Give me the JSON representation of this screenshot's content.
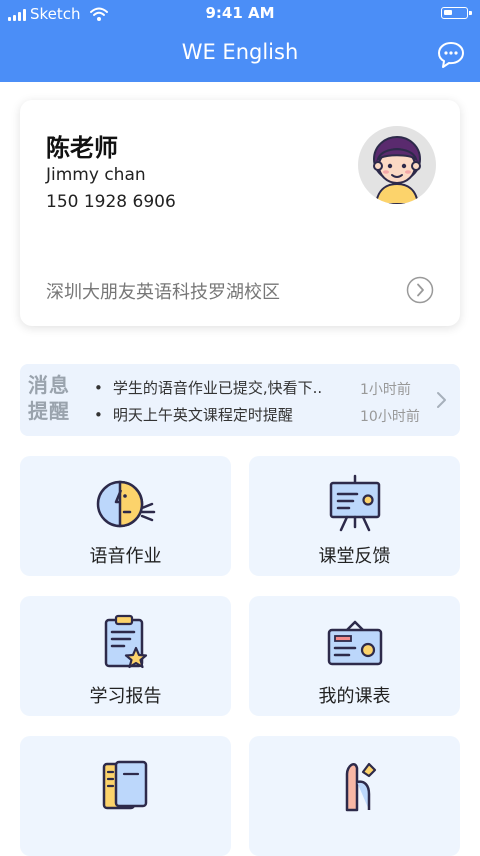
{
  "status_bar": {
    "carrier": "Sketch",
    "time": "9:41 AM"
  },
  "header": {
    "title": "WE English",
    "chat_icon": "chat-bubble-icon"
  },
  "profile": {
    "name": "陈老师",
    "english_name": "Jimmy chan",
    "phone": "150 1928 6906",
    "school": "深圳大朋友英语科技罗湖校区",
    "avatar_icon": "teacher-avatar"
  },
  "notifications": {
    "label_line1": "消息",
    "label_line2": "提醒",
    "items": [
      {
        "text": "学生的语音作业已提交,快看下..",
        "time": "1小时前"
      },
      {
        "text": "明天上午英文课程定时提醒",
        "time": "10小时前"
      }
    ]
  },
  "menu": [
    {
      "label": "语音作业",
      "icon": "voice-homework-icon"
    },
    {
      "label": "课堂反馈",
      "icon": "class-feedback-icon"
    },
    {
      "label": "学习报告",
      "icon": "study-report-icon"
    },
    {
      "label": "我的课表",
      "icon": "my-schedule-icon"
    },
    {
      "label": "",
      "icon": "notebook-icon"
    },
    {
      "label": "",
      "icon": "hand-icon"
    }
  ],
  "colors": {
    "header_bg": "#4b8ef7",
    "tile_bg": "#eef5fe",
    "notice_bg": "#ecf3fd",
    "icon_stroke": "#2d2a4a",
    "icon_yellow": "#fcd36b",
    "icon_blue": "#bcd7fb"
  }
}
